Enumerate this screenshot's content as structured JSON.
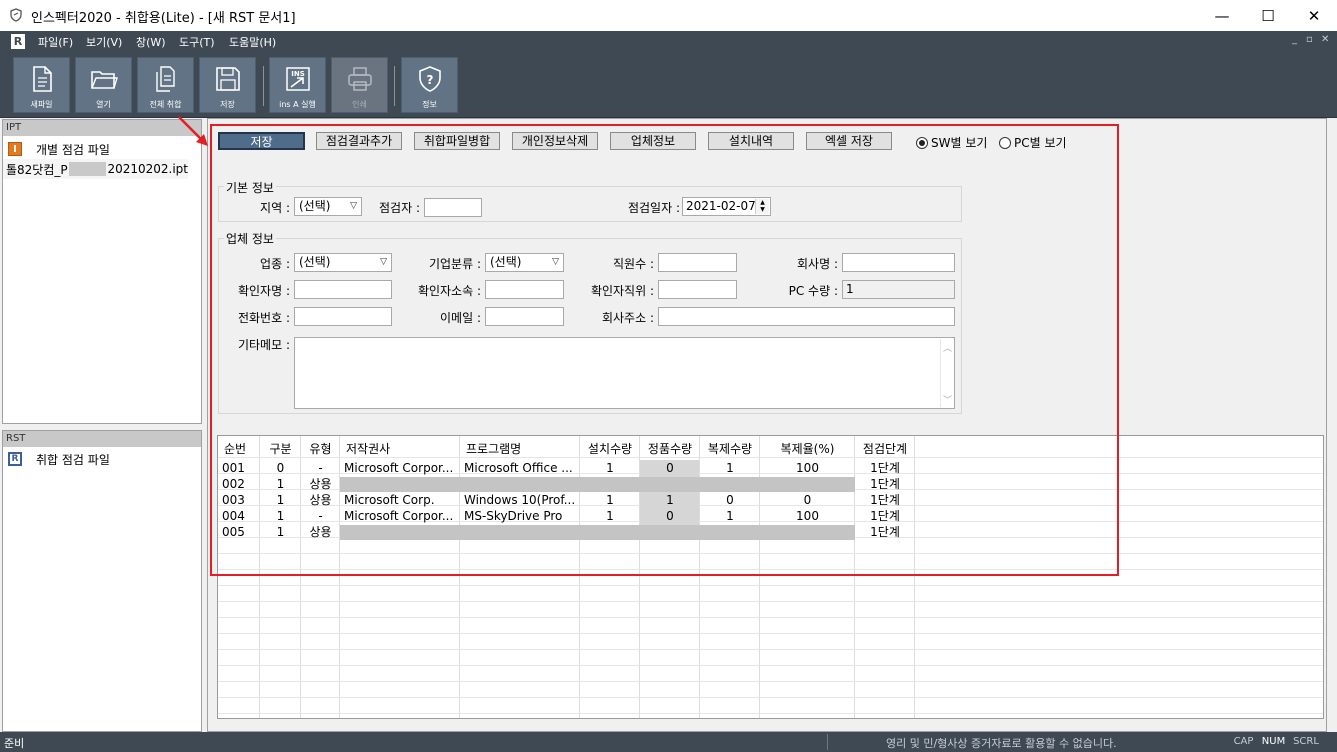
{
  "window": {
    "title": "인스펙터2020 - 취합용(Lite) - [새 RST 문서1]",
    "minimize": "—",
    "maximize": "☐",
    "close": "✕"
  },
  "menu": {
    "logo": "R",
    "items": [
      "파일(F)",
      "보기(V)",
      "창(W)",
      "도구(T)",
      "도움말(H)"
    ],
    "mdi": [
      "_",
      "▫",
      "✕"
    ]
  },
  "toolbar": {
    "buttons": [
      {
        "label": "새파일",
        "icon": "new-file-icon"
      },
      {
        "label": "열기",
        "icon": "folder-open-icon"
      },
      {
        "label": "전체 취합",
        "icon": "merge-all-icon"
      },
      {
        "label": "저장",
        "icon": "save-icon"
      },
      {
        "label": "ins A 실행",
        "icon": "ins-run-icon"
      },
      {
        "label": "인쇄",
        "icon": "print-icon"
      },
      {
        "label": "정보",
        "icon": "info-shield-icon"
      }
    ]
  },
  "left": {
    "ipt_header": "IPT",
    "ipt_item": "개별 점검 파일",
    "ipt_file_prefix": "톨82닷컴_P",
    "ipt_file_suffix": "20210202.ipt",
    "rst_header": "RST",
    "rst_item": "취합 점검 파일"
  },
  "actions": {
    "save": "저장",
    "add_result": "점검결과추가",
    "merge_files": "취합파일병합",
    "delete_personal": "개인정보삭제",
    "company_info": "업체정보",
    "install_history": "설치내역",
    "excel_save": "엑셀 저장",
    "view_sw": "SW별 보기",
    "view_pc": "PC별 보기"
  },
  "basic": {
    "group_title": "기본 정보",
    "region_label": "지역 :",
    "region_value": "(선택)",
    "inspector_label": "점검자 :",
    "inspector_value": "",
    "date_label": "점검일자 :",
    "date_value": "2021-02-07"
  },
  "company": {
    "group_title": "업체 정보",
    "industry_label": "업종 :",
    "industry_value": "(선택)",
    "category_label": "기업분류 :",
    "category_value": "(선택)",
    "employees_label": "직원수 :",
    "employees_value": "",
    "company_name_label": "회사명 :",
    "company_name_value": "",
    "confirmer_label": "확인자명 :",
    "confirmer_value": "",
    "confirmer_dept_label": "확인자소속 :",
    "confirmer_dept_value": "",
    "confirmer_title_label": "확인자직위 :",
    "confirmer_title_value": "",
    "pc_count_label": "PC 수량 :",
    "pc_count_value": "1",
    "phone_label": "전화번호 :",
    "phone_value": "",
    "email_label": "이메일 :",
    "email_value": "",
    "address_label": "회사주소 :",
    "address_value": "",
    "memo_label": "기타메모 :",
    "memo_value": ""
  },
  "grid": {
    "headers": [
      "순번",
      "구분",
      "유형",
      "저작권사",
      "프로그램명",
      "설치수량",
      "정품수량",
      "복제수량",
      "복제율(%)",
      "점검단계"
    ],
    "rows": [
      [
        "001",
        "0",
        "-",
        "Microsoft Corpor...",
        "Microsoft Office ...",
        "1",
        "0",
        "1",
        "100",
        "1단계"
      ],
      [
        "002",
        "1",
        "상용",
        "",
        "",
        "",
        "",
        "",
        "",
        "1단계"
      ],
      [
        "003",
        "1",
        "상용",
        "Microsoft Corp.",
        "Windows 10(Prof...",
        "1",
        "1",
        "0",
        "0",
        "1단계"
      ],
      [
        "004",
        "1",
        "-",
        "Microsoft Corpor...",
        "MS-SkyDrive Pro",
        "1",
        "0",
        "1",
        "100",
        "1단계"
      ],
      [
        "005",
        "1",
        "상용",
        "",
        "",
        "",
        "",
        "",
        "",
        "1단계"
      ]
    ]
  },
  "status": {
    "ready": "준비",
    "notice": "영리 및 민/형사상 증거자료로 활용할 수 없습니다.",
    "cap": "CAP",
    "num": "NUM",
    "scrl": "SCRL"
  },
  "colors": {
    "chrome": "#3f4954",
    "highlight_box": "#e31e24",
    "primary_button": "#4f6c8a"
  }
}
